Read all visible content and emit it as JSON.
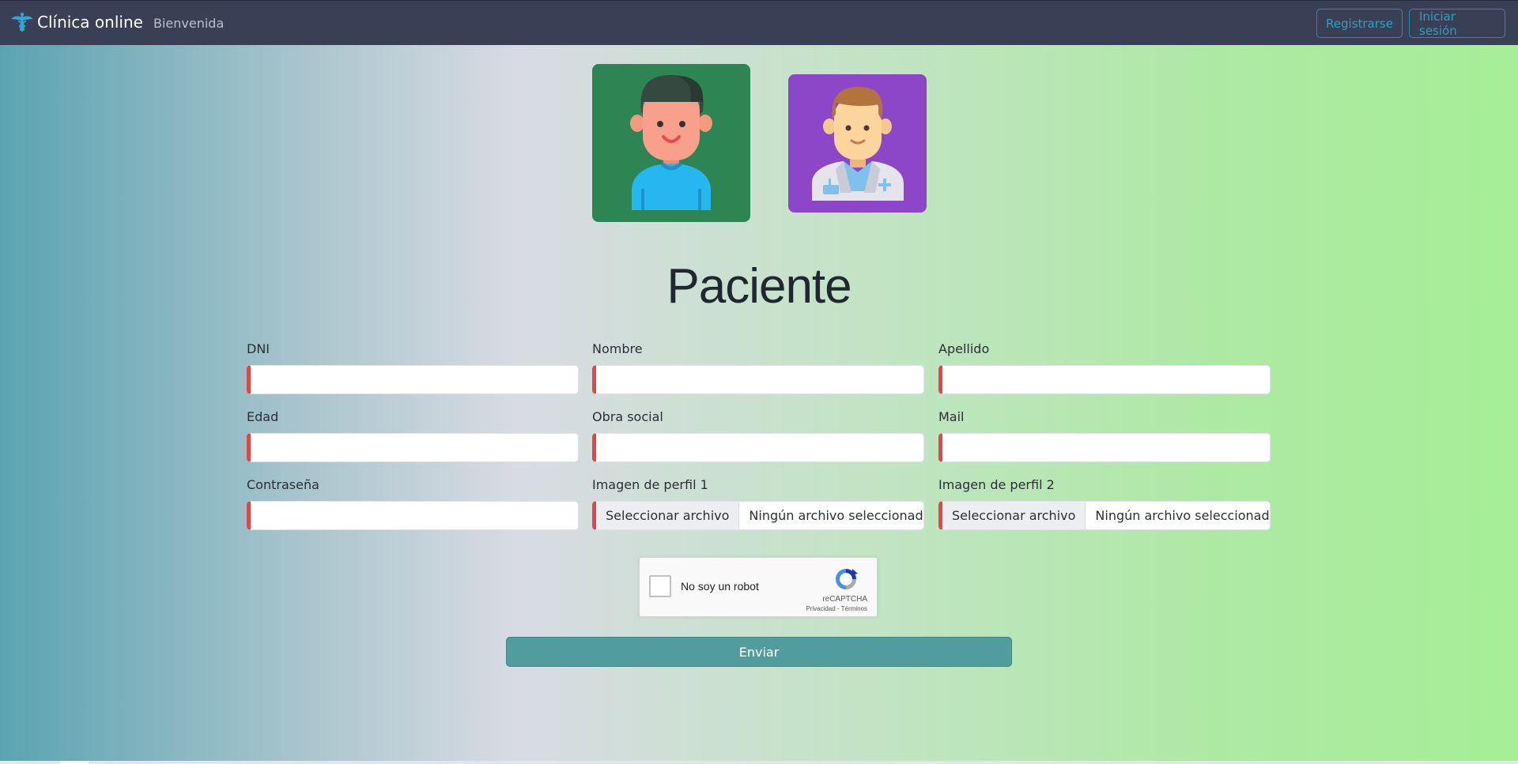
{
  "navbar": {
    "brand": "Clínica online",
    "links": [
      "Bienvenida"
    ],
    "register_label": "Registrarse",
    "login_label": "Iniciar sesión"
  },
  "profiles": [
    {
      "type": "patient",
      "bg_color": "#2e8554"
    },
    {
      "type": "doctor",
      "bg_color": "#8c47c8"
    }
  ],
  "form": {
    "title": "Paciente",
    "fields": {
      "dni": {
        "label": "DNI",
        "value": ""
      },
      "nombre": {
        "label": "Nombre",
        "value": ""
      },
      "apellido": {
        "label": "Apellido",
        "value": ""
      },
      "edad": {
        "label": "Edad",
        "value": ""
      },
      "obra_social": {
        "label": "Obra social",
        "value": ""
      },
      "mail": {
        "label": "Mail",
        "value": ""
      },
      "contrasena": {
        "label": "Contraseña",
        "value": ""
      },
      "imagen1": {
        "label": "Imagen de perfil 1",
        "button": "Seleccionar archivo",
        "status": "Ningún archivo seleccionado"
      },
      "imagen2": {
        "label": "Imagen de perfil 2",
        "button": "Seleccionar archivo",
        "status": "Ningún archivo seleccionado"
      }
    },
    "captcha": {
      "label": "No soy un robot",
      "brand": "reCAPTCHA",
      "links": "Privacidad - Términos"
    },
    "submit_label": "Enviar"
  },
  "colors": {
    "navbar_bg": "#394056",
    "accent": "#2fa0bd",
    "required_marker": "#e04848",
    "submit_bg": "#519c9d"
  }
}
